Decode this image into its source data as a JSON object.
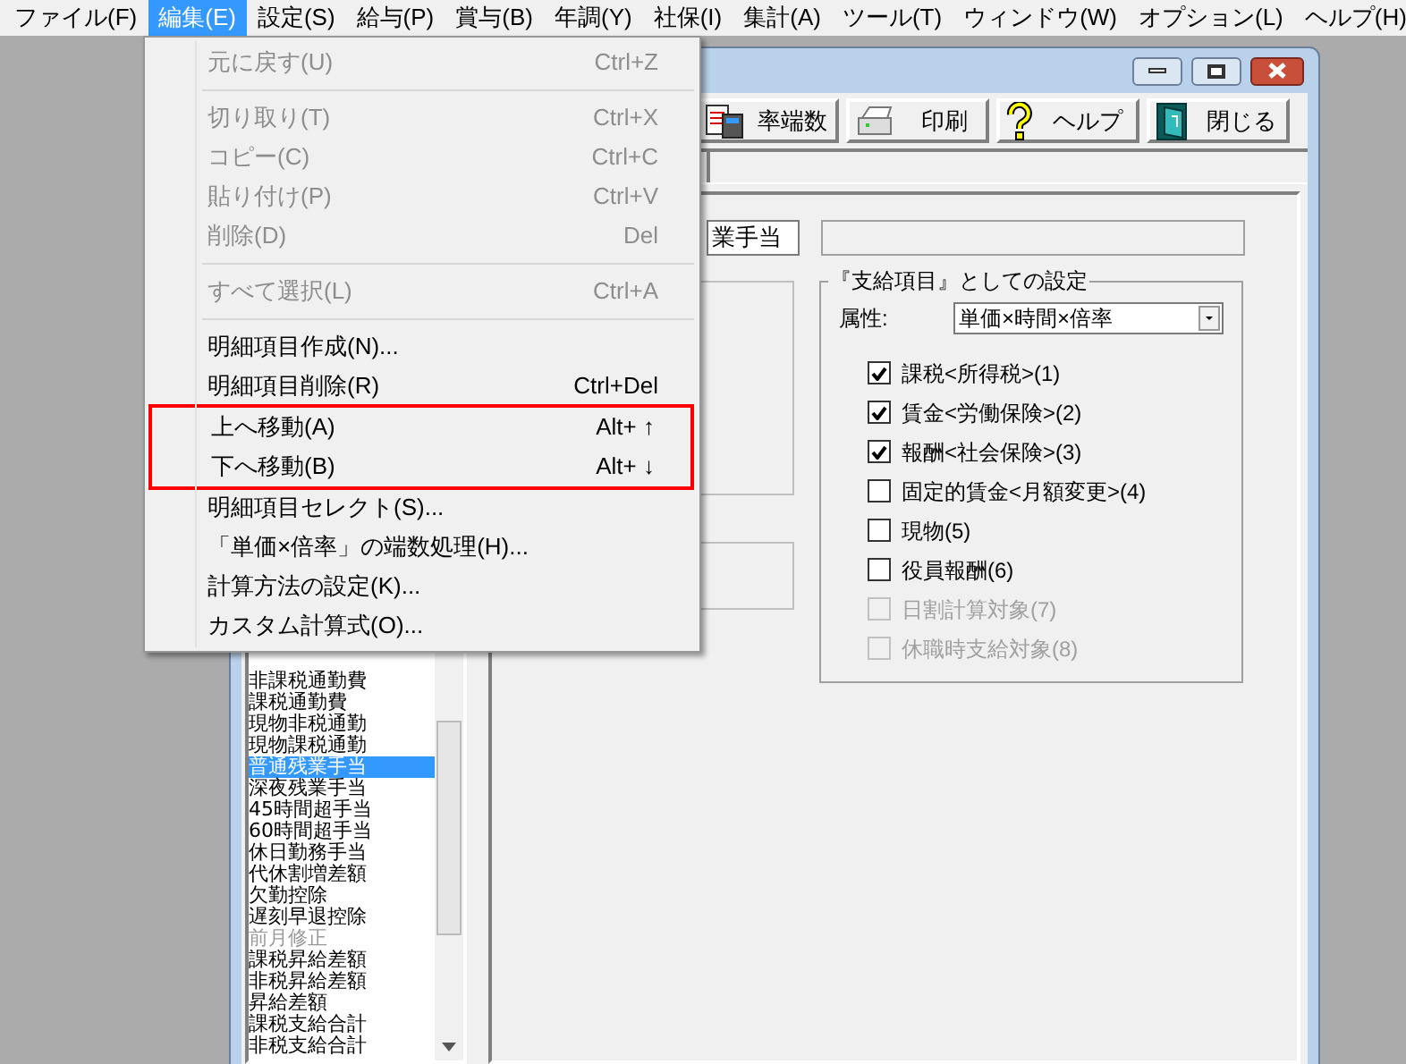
{
  "menubar": [
    {
      "label": "ファイル(F)",
      "selected": false
    },
    {
      "label": "編集(E)",
      "selected": true
    },
    {
      "label": "設定(S)",
      "selected": false
    },
    {
      "label": "給与(P)",
      "selected": false
    },
    {
      "label": "賞与(B)",
      "selected": false
    },
    {
      "label": "年調(Y)",
      "selected": false
    },
    {
      "label": "社保(I)",
      "selected": false
    },
    {
      "label": "集計(A)",
      "selected": false
    },
    {
      "label": "ツール(T)",
      "selected": false
    },
    {
      "label": "ウィンドウ(W)",
      "selected": false
    },
    {
      "label": "オプション(L)",
      "selected": false
    },
    {
      "label": "ヘルプ(H)",
      "selected": false
    }
  ],
  "edit_menu": [
    {
      "kind": "item",
      "label": "元に戻す(U)",
      "shortcut": "Ctrl+Z",
      "disabled": true,
      "framed": false
    },
    {
      "kind": "separator"
    },
    {
      "kind": "item",
      "label": "切り取り(T)",
      "shortcut": "Ctrl+X",
      "disabled": true,
      "framed": false
    },
    {
      "kind": "item",
      "label": "コピー(C)",
      "shortcut": "Ctrl+C",
      "disabled": true,
      "framed": false
    },
    {
      "kind": "item",
      "label": "貼り付け(P)",
      "shortcut": "Ctrl+V",
      "disabled": true,
      "framed": false
    },
    {
      "kind": "item",
      "label": "削除(D)",
      "shortcut": "Del",
      "disabled": true,
      "framed": false
    },
    {
      "kind": "separator"
    },
    {
      "kind": "item",
      "label": "すべて選択(L)",
      "shortcut": "Ctrl+A",
      "disabled": true,
      "framed": false
    },
    {
      "kind": "separator"
    },
    {
      "kind": "item",
      "label": "明細項目作成(N)...",
      "disabled": false,
      "framed": false
    },
    {
      "kind": "item",
      "label": "明細項目削除(R)",
      "shortcut": "Ctrl+Del",
      "disabled": false,
      "framed": false
    },
    {
      "kind": "item",
      "label": "上へ移動(A)",
      "shortcut": "Alt+ ↑",
      "disabled": false,
      "framed": true
    },
    {
      "kind": "item",
      "label": "下へ移動(B)",
      "shortcut": "Alt+ ↓",
      "disabled": false,
      "framed": true
    },
    {
      "kind": "item",
      "label": "明細項目セレクト(S)...",
      "disabled": false,
      "framed": false
    },
    {
      "kind": "item",
      "label": "「単価×倍率」の端数処理(H)...",
      "disabled": false,
      "framed": false
    },
    {
      "kind": "item",
      "label": "計算方法の設定(K)...",
      "disabled": false,
      "framed": false
    },
    {
      "kind": "item",
      "label": "カスタム計算式(O)...",
      "disabled": false,
      "framed": false
    }
  ],
  "toolbar": [
    {
      "label": "率端数"
    },
    {
      "label": "印刷"
    },
    {
      "label": "ヘルプ"
    },
    {
      "label": "閉じる"
    }
  ],
  "items_list": [
    {
      "label": "非課税通勤費",
      "selected": false,
      "disabled": false
    },
    {
      "label": "課税通勤費",
      "selected": false,
      "disabled": false
    },
    {
      "label": "現物非税通勤",
      "selected": false,
      "disabled": false
    },
    {
      "label": "現物課税通勤",
      "selected": false,
      "disabled": false
    },
    {
      "label": "普通残業手当",
      "selected": true,
      "disabled": false
    },
    {
      "label": "深夜残業手当",
      "selected": false,
      "disabled": false
    },
    {
      "label": "45時間超手当",
      "selected": false,
      "disabled": false
    },
    {
      "label": "60時間超手当",
      "selected": false,
      "disabled": false
    },
    {
      "label": "休日勤務手当",
      "selected": false,
      "disabled": false
    },
    {
      "label": "代休割増差額",
      "selected": false,
      "disabled": false
    },
    {
      "label": "欠勤控除",
      "selected": false,
      "disabled": false
    },
    {
      "label": "遅刻早退控除",
      "selected": false,
      "disabled": false
    },
    {
      "label": "前月修正",
      "selected": false,
      "disabled": true
    },
    {
      "label": "課税昇給差額",
      "selected": false,
      "disabled": false
    },
    {
      "label": "非税昇給差額",
      "selected": false,
      "disabled": false
    },
    {
      "label": "昇給差額",
      "selected": false,
      "disabled": false
    },
    {
      "label": "課税支給合計",
      "selected": false,
      "disabled": false
    },
    {
      "label": "非税支給合計",
      "selected": false,
      "disabled": false
    }
  ],
  "name_field": {
    "value": "業手当"
  },
  "settings": {
    "title": "『支給項目』としての設定",
    "attribute_label": "属性:",
    "attribute_value": "単価×時間×倍率",
    "checks": [
      {
        "label": "課税<所得税>(1)",
        "checked": true,
        "disabled": false
      },
      {
        "label": "賃金<労働保険>(2)",
        "checked": true,
        "disabled": false
      },
      {
        "label": "報酬<社会保険>(3)",
        "checked": true,
        "disabled": false
      },
      {
        "label": "固定的賃金<月額変更>(4)",
        "checked": false,
        "disabled": false
      },
      {
        "label": "現物(5)",
        "checked": false,
        "disabled": false
      },
      {
        "label": "役員報酬(6)",
        "checked": false,
        "disabled": false
      },
      {
        "label": "日割計算対象(7)",
        "checked": false,
        "disabled": true
      },
      {
        "label": "休職時支給対象(8)",
        "checked": false,
        "disabled": true
      }
    ]
  }
}
